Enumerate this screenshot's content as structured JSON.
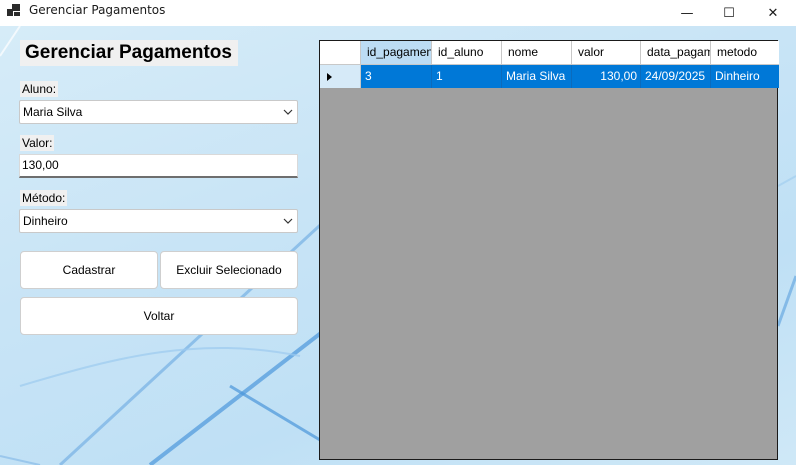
{
  "window": {
    "title": "Gerenciar Pagamentos",
    "minimize_glyph": "—",
    "maximize_glyph": "☐",
    "close_glyph": "✕"
  },
  "form": {
    "heading": "Gerenciar Pagamentos",
    "aluno": {
      "label": "Aluno:",
      "value": "Maria Silva"
    },
    "valor": {
      "label": "Valor:",
      "value": "130,00"
    },
    "metodo": {
      "label": "Método:",
      "value": "Dinheiro"
    },
    "buttons": {
      "cadastrar": "Cadastrar",
      "excluir": "Excluir Selecionado",
      "voltar": "Voltar"
    }
  },
  "grid": {
    "columns": [
      "id_pagamento",
      "id_aluno",
      "nome",
      "valor",
      "data_pagamento",
      "metodo"
    ],
    "rows": [
      [
        "3",
        "1",
        "Maria Silva",
        "130,00",
        "24/09/2025",
        "Dinheiro"
      ]
    ],
    "selected_row_color": "#0078d7"
  },
  "icons": [
    "app-icon",
    "chevron-down-icon",
    "row-pointer-icon"
  ]
}
